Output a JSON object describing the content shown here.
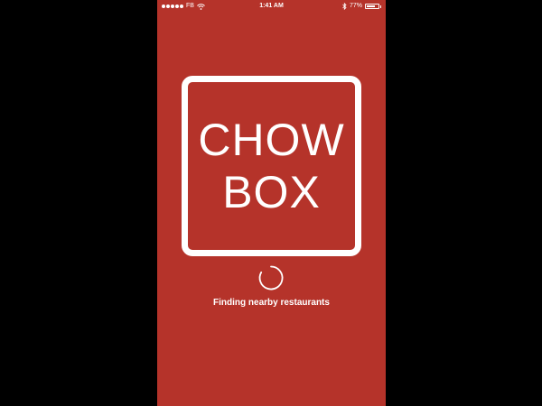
{
  "status_bar": {
    "carrier": "FB",
    "time": "1:41 AM",
    "battery_percent": "77%",
    "battery_level": 0.77,
    "icons": [
      "signal-dots-icon",
      "wifi-icon",
      "bluetooth-icon",
      "battery-icon"
    ]
  },
  "logo": {
    "line1": "CHOW",
    "line2": "BOX"
  },
  "loading": {
    "message": "Finding nearby restaurants"
  },
  "colors": {
    "background": "#b5332a",
    "foreground": "#ffffff",
    "letterbox": "#000000"
  }
}
